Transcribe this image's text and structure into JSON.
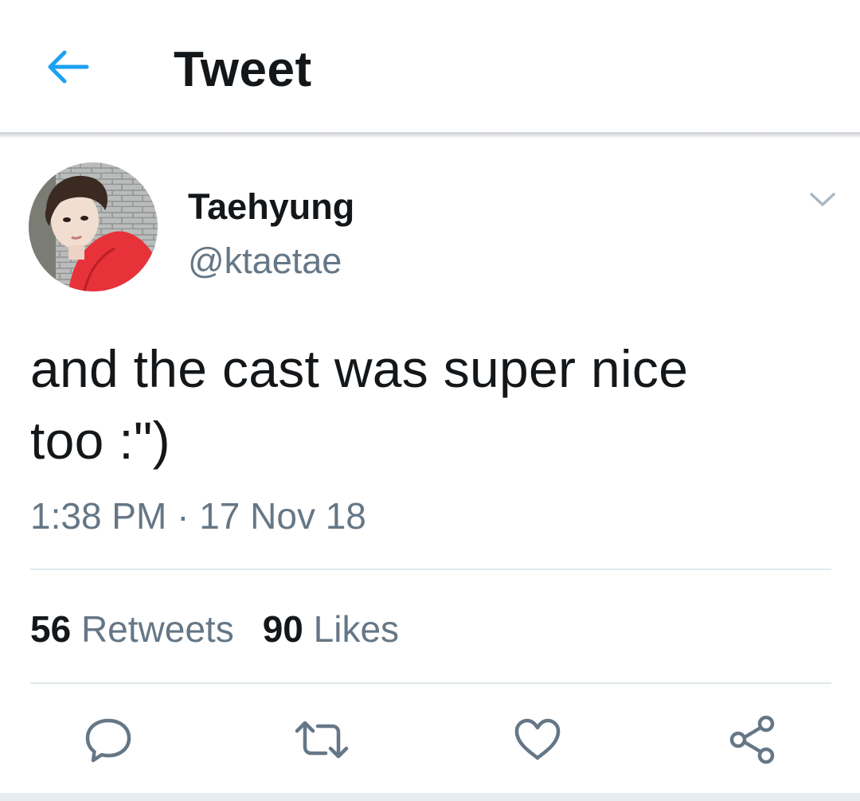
{
  "header": {
    "title": "Tweet",
    "back_icon": "arrow-left-icon",
    "accent_color": "#1da1f2"
  },
  "tweet": {
    "author": {
      "display_name": "Taehyung",
      "handle": "@ktaetae",
      "avatar": "profile-photo"
    },
    "more_icon": "chevron-down-icon",
    "text_lines": [
      "and the cast was super nice",
      "too :\")"
    ],
    "timestamp": "1:38 PM · 17 Nov 18",
    "stats": {
      "retweets_count": "56",
      "retweets_label": "Retweets",
      "likes_count": "90",
      "likes_label": "Likes"
    },
    "actions": [
      {
        "name": "reply",
        "icon": "reply-bubble-icon"
      },
      {
        "name": "retweet",
        "icon": "retweet-icon"
      },
      {
        "name": "like",
        "icon": "heart-icon"
      },
      {
        "name": "share",
        "icon": "share-icon"
      }
    ]
  },
  "colors": {
    "text_primary": "#14171a",
    "text_secondary": "#657786",
    "divider": "#e1e8ed"
  }
}
